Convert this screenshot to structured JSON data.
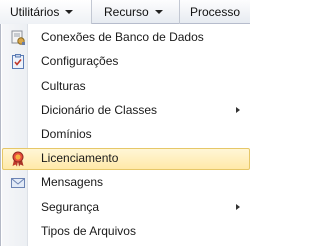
{
  "menubar": {
    "items": [
      {
        "label": "Utilitários"
      },
      {
        "label": "Recurso"
      },
      {
        "label": "Processo"
      }
    ]
  },
  "menu": {
    "items": [
      {
        "label": "Conexões de Banco de Dados",
        "icon": "database-connection-icon"
      },
      {
        "label": "Configurações",
        "icon": "settings-checklist-icon"
      },
      {
        "label": "Culturas"
      },
      {
        "label": "Dicionário de Classes",
        "has_submenu": true
      },
      {
        "label": "Domínios"
      },
      {
        "label": "Licenciamento",
        "icon": "license-ribbon-icon",
        "highlighted": true
      },
      {
        "label": "Mensagens",
        "icon": "envelope-icon"
      },
      {
        "label": "Segurança",
        "has_submenu": true
      },
      {
        "label": "Tipos de Arquivos"
      }
    ]
  },
  "colors": {
    "highlight_bg": "#ffe9a8",
    "highlight_border": "#e6c768",
    "menubar_bg": "#e7ebf1"
  }
}
